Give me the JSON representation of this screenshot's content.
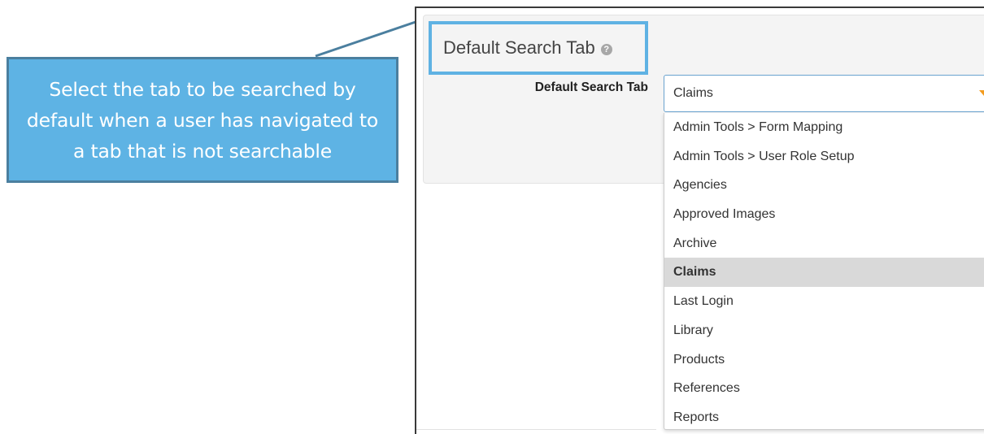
{
  "callout": {
    "text": "Select the tab to be searched by default when a user has navigated to a tab that is not searchable",
    "fill_color": "#5eb3e4",
    "border_color": "#4b7f9f",
    "text_color": "#ffffff"
  },
  "section": {
    "title": "Default Search Tab",
    "help_icon": "?",
    "highlight_color": "#5fb2e3"
  },
  "field": {
    "label": "Default Search Tab",
    "selected_value": "Claims",
    "arrow_color": "#f39c1f",
    "icon": "caret-down-icon"
  },
  "dropdown": {
    "options": [
      "Admin Tools > Form Mapping",
      "Admin Tools > User Role Setup",
      "Agencies",
      "Approved Images",
      "Archive",
      "Claims",
      "Last Login",
      "Library",
      "Products",
      "References",
      "Reports"
    ],
    "selected_index": 5
  }
}
